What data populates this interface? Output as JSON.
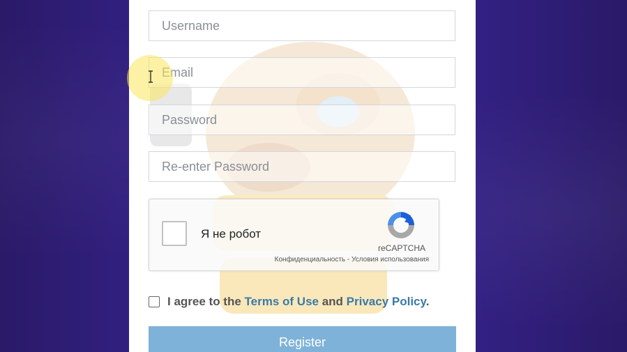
{
  "form": {
    "username_placeholder": "Username",
    "email_placeholder": "Email",
    "password_placeholder": "Password",
    "reenter_password_placeholder": "Re-enter Password"
  },
  "recaptcha": {
    "checkbox_label": "Я не робот",
    "brand": "reCAPTCHA",
    "privacy_link": "Конфиденциальность",
    "separator": " - ",
    "terms_link": "Условия использования"
  },
  "agree": {
    "prefix": "I agree to the ",
    "terms_link": "Terms of Use",
    "and": " and ",
    "privacy_link": "Privacy Policy",
    "suffix": "."
  },
  "register_button": "Register",
  "colors": {
    "background": "#2c1d6e",
    "panel": "#ffffff",
    "register_button": "#7fb2d8",
    "link": "#3a7aa6"
  },
  "icons": {
    "recaptcha": "recaptcha-logo-icon",
    "cursor": "text-cursor-icon"
  }
}
